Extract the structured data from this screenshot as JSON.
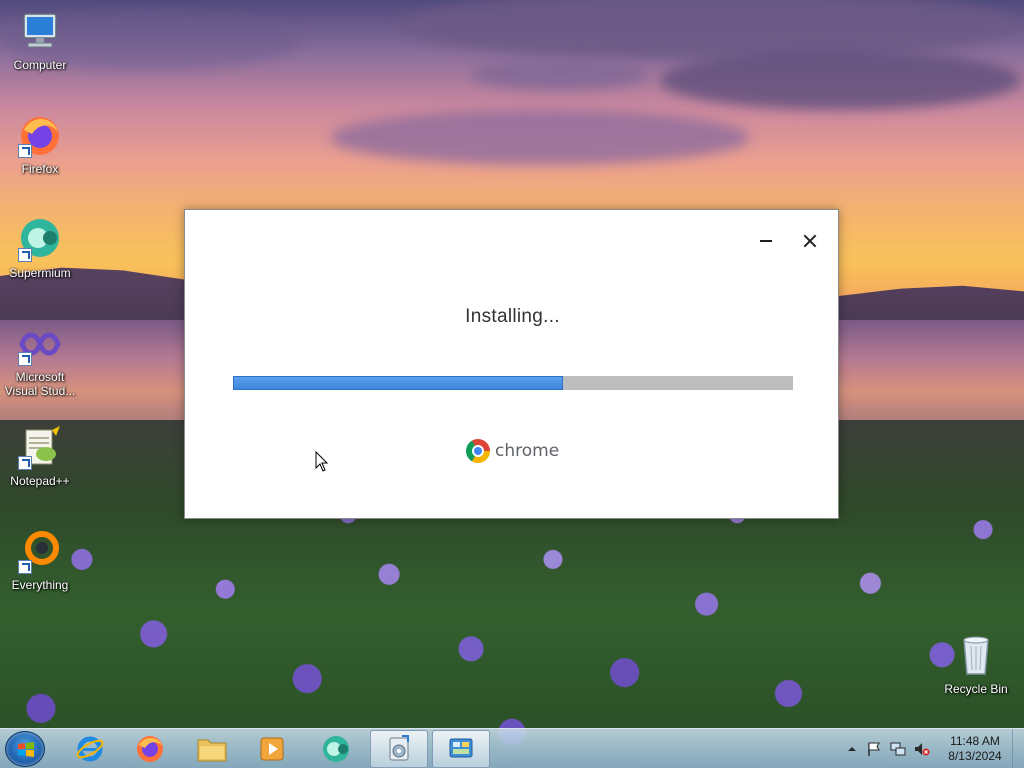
{
  "desktop": {
    "icons": [
      {
        "label": "Computer",
        "icon": "computer-icon"
      },
      {
        "label": "Firefox",
        "icon": "firefox-icon"
      },
      {
        "label": "Supermium",
        "icon": "supermium-icon"
      },
      {
        "label": "Microsoft Visual Stud...",
        "icon": "visual-studio-icon"
      },
      {
        "label": "Notepad++",
        "icon": "notepadpp-icon"
      },
      {
        "label": "Everything",
        "icon": "everything-icon"
      },
      {
        "label": "Recycle Bin",
        "icon": "recycle-bin-icon"
      }
    ]
  },
  "installer": {
    "status": "Installing...",
    "progress_percent": 59,
    "brand": "chrome",
    "colors": {
      "progress_fill": "#3f86dd",
      "progress_track": "#bdbdbd"
    }
  },
  "taskbar": {
    "items": [
      {
        "name": "internet-explorer",
        "icon": "ie-icon",
        "active": false
      },
      {
        "name": "firefox",
        "icon": "firefox-icon",
        "active": false
      },
      {
        "name": "file-explorer",
        "icon": "folder-icon",
        "active": false
      },
      {
        "name": "media-player",
        "icon": "media-player-icon",
        "active": false
      },
      {
        "name": "supermium",
        "icon": "supermium-icon",
        "active": false
      },
      {
        "name": "chrome-installer",
        "icon": "installer-icon",
        "active": true
      },
      {
        "name": "control-panel",
        "icon": "control-panel-icon",
        "active": true
      }
    ],
    "clock": {
      "time": "11:48 AM",
      "date": "8/13/2024"
    }
  }
}
